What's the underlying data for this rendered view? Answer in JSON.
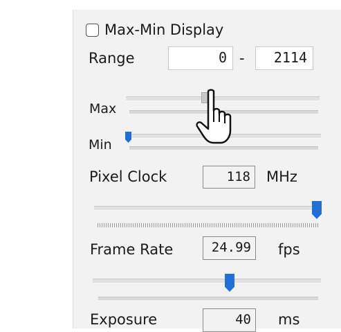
{
  "max_min_display": {
    "label": "Max-Min Display",
    "checked": false
  },
  "range": {
    "label": "Range",
    "min_value": "0",
    "separator": "-",
    "max_value": "2114"
  },
  "max": {
    "label": "Max"
  },
  "min": {
    "label": "Min"
  },
  "pixel_clock": {
    "label": "Pixel Clock",
    "value": "118",
    "unit": "MHz"
  },
  "frame_rate": {
    "label": "Frame Rate",
    "value": "24.99",
    "unit": "fps"
  },
  "exposure": {
    "label": "Exposure",
    "value": "40",
    "unit": "ms"
  },
  "colors": {
    "panel": "#f2f2f2",
    "slider_thumb": "#1f6fd6"
  },
  "icons": {
    "cursor": "hand-pointer-icon"
  }
}
